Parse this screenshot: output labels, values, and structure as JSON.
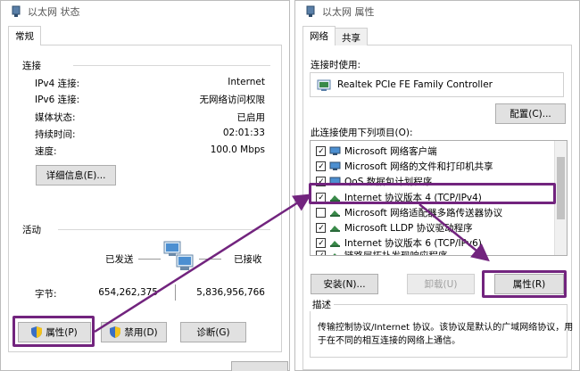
{
  "colors": {
    "highlight": "#72247e",
    "accent": "#0078d7",
    "disabled_text": "#a0a0a0"
  },
  "status_window": {
    "title": "以太网 状态",
    "tab": "常规",
    "connection_heading": "连接",
    "rows": [
      {
        "label": "IPv4 连接:",
        "value": "Internet"
      },
      {
        "label": "IPv6 连接:",
        "value": "无网络访问权限"
      },
      {
        "label": "媒体状态:",
        "value": "已启用"
      },
      {
        "label": "持续时间:",
        "value": "02:01:33"
      },
      {
        "label": "速度:",
        "value": "100.0 Mbps"
      }
    ],
    "details_button": "详细信息(E)...",
    "activity_heading": "活动",
    "sent_label": "已发送",
    "received_label": "已接收",
    "bytes_label": "字节:",
    "bytes_sent": "654,262,375",
    "bytes_received": "5,836,956,766",
    "buttons": {
      "properties": "属性(P)",
      "disable": "禁用(D)",
      "diagnose": "诊断(G)"
    }
  },
  "properties_window": {
    "title": "以太网 属性",
    "tabs": [
      "网络",
      "共享"
    ],
    "connect_using_label": "连接时使用:",
    "adapter": "Realtek PCIe FE Family Controller",
    "configure_button": "配置(C)...",
    "items_label": "此连接使用下列项目(O):",
    "items": [
      {
        "label": "Microsoft 网络客户端",
        "checked": true,
        "icon": "network-client-icon"
      },
      {
        "label": "Microsoft 网络的文件和打印机共享",
        "checked": true,
        "icon": "network-service-icon"
      },
      {
        "label": "QoS 数据包计划程序",
        "checked": true,
        "icon": "network-service-icon"
      },
      {
        "label": "Internet 协议版本 4 (TCP/IPv4)",
        "checked": true,
        "icon": "protocol-icon"
      },
      {
        "label": "Microsoft 网络适配器多路传送器协议",
        "checked": false,
        "icon": "protocol-icon"
      },
      {
        "label": "Microsoft LLDP 协议驱动程序",
        "checked": true,
        "icon": "protocol-icon"
      },
      {
        "label": "Internet 协议版本 6 (TCP/IPv6)",
        "checked": true,
        "icon": "protocol-icon"
      },
      {
        "label": "链路层拓扑发现响应程序",
        "checked": true,
        "icon": "protocol-icon"
      }
    ],
    "install_button": "安装(N)...",
    "uninstall_button": "卸载(U)",
    "properties_button": "属性(R)",
    "description_heading": "描述",
    "description_text_1": "传输控制协议/Internet 协议。该协议是默认的广域网络协议，用",
    "description_text_2": "于在不同的相互连接的网络上通信。"
  }
}
